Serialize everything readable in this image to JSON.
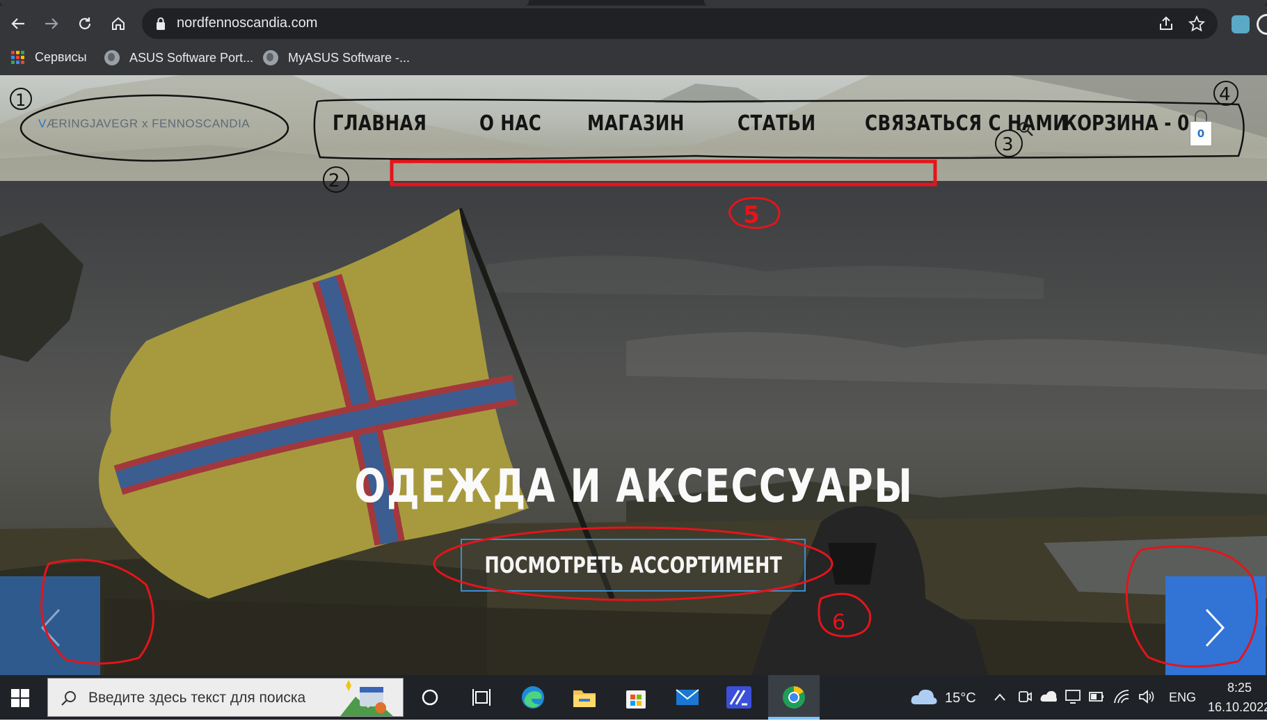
{
  "browser": {
    "url": "nordfennoscandia.com",
    "bookmarks": [
      {
        "label": "Сервисы",
        "icon": "apps-icon"
      },
      {
        "label": "ASUS Software Port...",
        "icon": "globe-icon"
      },
      {
        "label": "MyASUS Software -...",
        "icon": "globe-icon"
      }
    ]
  },
  "site": {
    "logo_v": "V",
    "logo_rest": "ÆRINGJAVEGR",
    "logo_x": "x",
    "logo_tail": "FENNOSCANDIA",
    "menu": [
      "ГЛАВНАЯ",
      "О НАС",
      "МАГАЗИН",
      "СТАТЬИ",
      "СВЯЗАТЬСЯ С НАМИ"
    ],
    "cart_label": "КОРЗИНА - 0",
    "cart_count": "0",
    "hero_title": "ОДЕЖДА И АКСЕССУАРЫ",
    "cta_label": "ПОСМОТРЕТЬ АССОРТИМЕНТ"
  },
  "annotations": [
    "1",
    "2",
    "3",
    "4",
    "5",
    "6"
  ],
  "taskbar": {
    "search_placeholder": "Введите здесь текст для поиска",
    "temperature": "15°C",
    "language": "ENG",
    "time": "8:25",
    "date": "16.10.2022"
  },
  "colors": {
    "browser_bg": "#35363a",
    "omnibox_bg": "#202124",
    "accent_blue": "#3273d6",
    "annotation_red": "#e5141b",
    "taskbar_bg": "#1f2328"
  }
}
